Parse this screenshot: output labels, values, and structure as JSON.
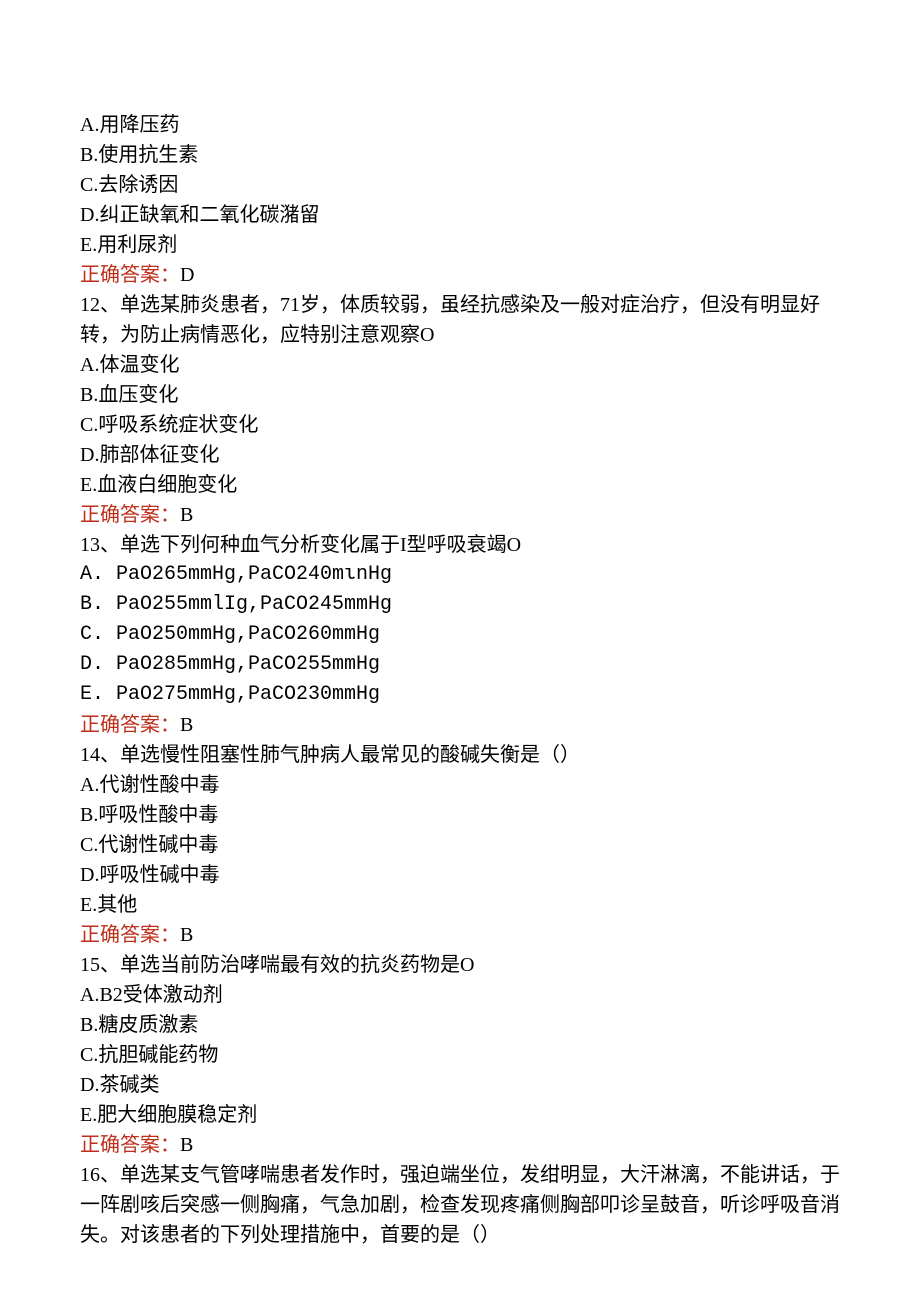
{
  "q11": {
    "optA": "A.用降压药",
    "optB": "B.使用抗生素",
    "optC": "C.去除诱因",
    "optD": "D.纠正缺氧和二氧化碳潴留",
    "optE": "E.用利尿剂",
    "answerLabel": "正确答案：",
    "answerValue": "D"
  },
  "q12": {
    "stem": "12、单选某肺炎患者，71岁，体质较弱，虽经抗感染及一般对症治疗，但没有明显好转，为防止病情恶化，应特别注意观察O",
    "optA": "A.体温变化",
    "optB": "B.血压变化",
    "optC": "C.呼吸系统症状变化",
    "optD": "D.肺部体征变化",
    "optE": "E.血液白细胞变化",
    "answerLabel": "正确答案：",
    "answerValue": "B"
  },
  "q13": {
    "stem": "13、单选下列何种血气分析变化属于I型呼吸衰竭O",
    "optA": "A. PaO265mmHg,PaCO240mιnHg",
    "optB": "B. PaO255mmlIg,PaCO245mmHg",
    "optC": "C. PaO250mmHg,PaCO260mmHg",
    "optD": "D. PaO285mmHg,PaCO255mmHg",
    "optE": "E. PaO275mmHg,PaCO230mmHg",
    "answerLabel": "正确答案：",
    "answerValue": "B"
  },
  "q14": {
    "stem": "14、单选慢性阻塞性肺气肿病人最常见的酸碱失衡是（）",
    "optA": "A.代谢性酸中毒",
    "optB": "B.呼吸性酸中毒",
    "optC": "C.代谢性碱中毒",
    "optD": "D.呼吸性碱中毒",
    "optE": "E.其他",
    "answerLabel": "正确答案：",
    "answerValue": "B"
  },
  "q15": {
    "stem": "15、单选当前防治哮喘最有效的抗炎药物是O",
    "optA": "A.B2受体激动剂",
    "optB": "B.糖皮质激素",
    "optC": "C.抗胆碱能药物",
    "optD": "D.茶碱类",
    "optE": "E.肥大细胞膜稳定剂",
    "answerLabel": "正确答案：",
    "answerValue": "B"
  },
  "q16": {
    "stem": "16、单选某支气管哮喘患者发作时，强迫端坐位，发绀明显，大汗淋漓，不能讲话，于一阵剧咳后突感一侧胸痛，气急加剧，检查发现疼痛侧胸部叩诊呈鼓音，听诊呼吸音消失。对该患者的下列处理措施中，首要的是（）"
  }
}
